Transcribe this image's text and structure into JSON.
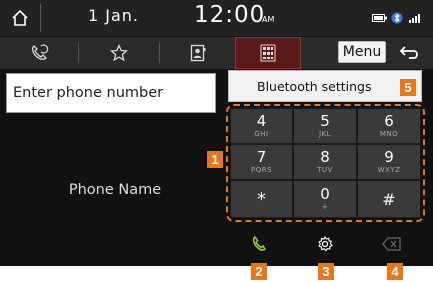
{
  "status": {
    "date": "1 Jan.",
    "time": "12:00",
    "ampm": "AM",
    "icons": [
      "home-icon",
      "battery-icon",
      "bluetooth-icon",
      "signal-icon"
    ]
  },
  "tabs": {
    "items": [
      {
        "name": "recent-calls",
        "icon": "phone-history-icon"
      },
      {
        "name": "favorites",
        "icon": "star-icon"
      },
      {
        "name": "contacts",
        "icon": "contacts-icon"
      },
      {
        "name": "keypad",
        "icon": "keypad-icon",
        "active": true
      }
    ],
    "menu_label": "Menu",
    "back_icon": "back-arrow-icon"
  },
  "input": {
    "placeholder": "Enter phone number"
  },
  "phone_name": "Phone Name",
  "popup": {
    "label": "Bluetooth settings"
  },
  "keypad": {
    "keys": [
      {
        "main": "4",
        "sub": "GHI"
      },
      {
        "main": "5",
        "sub": "JKL"
      },
      {
        "main": "6",
        "sub": "MNO"
      },
      {
        "main": "7",
        "sub": "PQRS"
      },
      {
        "main": "8",
        "sub": "TUV"
      },
      {
        "main": "9",
        "sub": "WXYZ"
      },
      {
        "main": "*",
        "sub": ""
      },
      {
        "main": "0",
        "sub": "+"
      },
      {
        "main": "#",
        "sub": ""
      }
    ]
  },
  "bottom": {
    "items": [
      {
        "name": "call",
        "icon": "phone-icon"
      },
      {
        "name": "settings",
        "icon": "gear-icon"
      },
      {
        "name": "delete",
        "icon": "backspace-icon"
      }
    ]
  },
  "callouts": [
    "1",
    "2",
    "3",
    "4",
    "5"
  ],
  "colors": {
    "accent": "#e8771a",
    "call_green": "#8cc63f",
    "active_tab": "#5a1a1a"
  }
}
